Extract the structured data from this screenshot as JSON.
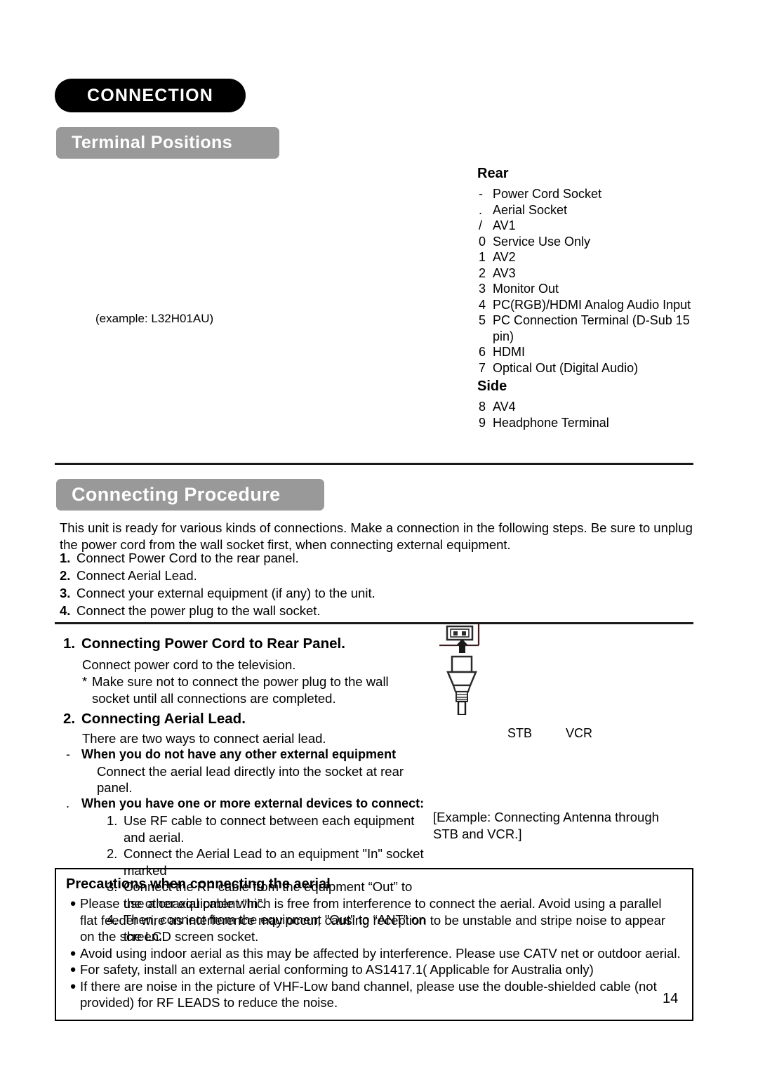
{
  "chapter": {
    "title": "CONNECTION"
  },
  "sections": {
    "terminal_positions": {
      "heading": "Terminal Positions"
    },
    "connecting_procedure": {
      "heading": "Connecting Procedure"
    }
  },
  "figure": {
    "example_caption": "(example: L32H01AU)"
  },
  "terminals": {
    "rear": {
      "title": "Rear",
      "items": [
        {
          "marker": "-",
          "label": "Power Cord Socket"
        },
        {
          "marker": ".",
          "label": "Aerial Socket"
        },
        {
          "marker": "/",
          "label": "AV1"
        },
        {
          "marker": "0",
          "label": "Service Use Only"
        },
        {
          "marker": "1",
          "label": "AV2"
        },
        {
          "marker": "2",
          "label": "AV3"
        },
        {
          "marker": "3",
          "label": "Monitor Out"
        },
        {
          "marker": "4",
          "label": "PC(RGB)/HDMI Analog Audio Input"
        },
        {
          "marker": "5",
          "label": "PC Connection Terminal (D-Sub 15 pin)"
        },
        {
          "marker": "6",
          "label": "HDMI"
        },
        {
          "marker": "7",
          "label": "Optical Out (Digital Audio)"
        }
      ]
    },
    "side": {
      "title": "Side",
      "items": [
        {
          "marker": "8",
          "label": "AV4"
        },
        {
          "marker": "9",
          "label": "Headphone Terminal"
        }
      ]
    }
  },
  "procedure": {
    "intro": "This unit is ready for various kinds of connections. Make a connection in the following steps. Be sure to unplug the power cord from the wall socket first, when connecting external equipment.",
    "steps": [
      {
        "num": "1.",
        "text": "Connect Power Cord to the rear panel."
      },
      {
        "num": "2.",
        "text": "Connect Aerial Lead."
      },
      {
        "num": "3.",
        "text": "Connect your external equipment (if any) to the unit."
      },
      {
        "num": "4.",
        "text": "Connect the power plug to the wall socket."
      }
    ]
  },
  "section1": {
    "num": "1.",
    "heading": "Connecting Power Cord to Rear Panel.",
    "line1": "Connect power cord to the television.",
    "note_marker": "*",
    "note": "Make sure not to connect the power plug to the wall socket until all connections are completed."
  },
  "section2": {
    "num": "2.",
    "heading": "Connecting Aerial Lead.",
    "intro": "There are two ways to connect aerial lead.",
    "way1": {
      "marker": "-",
      "title": "When you do not have any other external equipment",
      "desc": "Connect the aerial lead directly into the socket at rear panel."
    },
    "way2": {
      "marker": ".",
      "title": "When you have one or more external devices to connect:",
      "substeps": [
        {
          "num": "1.",
          "text": "Use RF cable to connect between each equipment and aerial."
        },
        {
          "num": "2.",
          "text": "Connect the Aerial Lead to an equipment \"In\" socket marked"
        },
        {
          "num": "3.",
          "text": "Connect the RF cable from the equipment “Out” to the other equipment “In”."
        },
        {
          "num": "4.",
          "text": "Then, connect from the equipment \"Out\" to “ANT” on the LCD screen socket."
        }
      ]
    }
  },
  "diagram": {
    "stb_label": "STB",
    "vcr_label": "VCR",
    "caption": "[Example: Connecting Antenna through STB and VCR.]"
  },
  "precautions": {
    "title": "Precautions when connecting the aerial",
    "bullet": "●",
    "items": [
      "Please use a coaxial cable which is free from interference to connect the aerial. Avoid using a parallel flat feeder wire as interference may occur, causing reception to be unstable and stripe noise to appear on the screen.",
      "Avoid using indoor aerial as this may be affected by interference. Please use CATV net or outdoor aerial.",
      "For safety, install an external aerial conforming to AS1417.1( Applicable for Australia only)",
      "If there are noise in the picture of VHF-Low band channel, please use the double-shielded cable (not provided) for RF LEADS to reduce the noise."
    ]
  },
  "footer": {
    "page_number": "14"
  }
}
